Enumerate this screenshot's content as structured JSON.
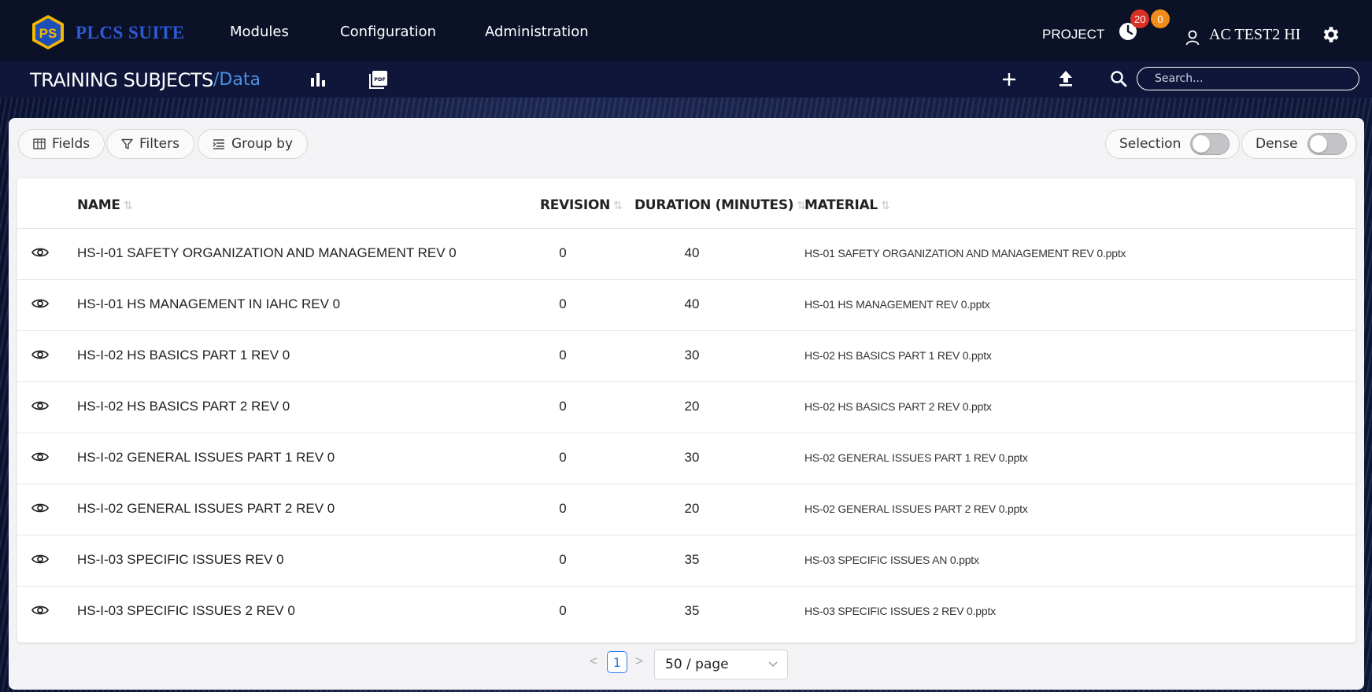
{
  "app": {
    "brand": "PLCS SUITE",
    "logo_text": "PS"
  },
  "nav": {
    "items": [
      "Modules",
      "Configuration",
      "Administration"
    ],
    "project_label": "PROJECT",
    "badge_red": "20",
    "badge_orange": "0",
    "user_name": "AC TEST2 HI"
  },
  "subheader": {
    "title": "TRAINING SUBJECTS",
    "path": "/Data",
    "search_placeholder": "Search..."
  },
  "toolbar": {
    "fields_label": "Fields",
    "filters_label": "Filters",
    "groupby_label": "Group by",
    "selection_label": "Selection",
    "dense_label": "Dense"
  },
  "table": {
    "columns": {
      "name": "NAME",
      "revision": "REVISION",
      "duration": "DURATION (MINUTES)",
      "material": "MATERIAL"
    },
    "rows": [
      {
        "name": "HS-I-01 SAFETY ORGANIZATION AND MANAGEMENT REV 0",
        "revision": "0",
        "duration": "40",
        "material": "HS-01 SAFETY ORGANIZATION AND MANAGEMENT REV 0.pptx"
      },
      {
        "name": "HS-I-01 HS MANAGEMENT IN IAHC REV 0",
        "revision": "0",
        "duration": "40",
        "material": "HS-01 HS MANAGEMENT REV 0.pptx"
      },
      {
        "name": "HS-I-02 HS BASICS PART 1 REV 0",
        "revision": "0",
        "duration": "30",
        "material": "HS-02 HS BASICS PART 1 REV 0.pptx"
      },
      {
        "name": "HS-I-02 HS BASICS PART 2 REV 0",
        "revision": "0",
        "duration": "20",
        "material": "HS-02 HS BASICS PART 2 REV 0.pptx"
      },
      {
        "name": "HS-I-02 GENERAL ISSUES PART 1 REV 0",
        "revision": "0",
        "duration": "30",
        "material": "HS-02 GENERAL ISSUES PART 1 REV 0.pptx"
      },
      {
        "name": "HS-I-02 GENERAL ISSUES PART 2 REV 0",
        "revision": "0",
        "duration": "20",
        "material": "HS-02 GENERAL ISSUES PART 2 REV 0.pptx"
      },
      {
        "name": "HS-I-03 SPECIFIC ISSUES REV 0",
        "revision": "0",
        "duration": "35",
        "material": "HS-03 SPECIFIC ISSUES AN 0.pptx"
      },
      {
        "name": "HS-I-03 SPECIFIC ISSUES 2 REV 0",
        "revision": "0",
        "duration": "35",
        "material": "HS-03 SPECIFIC ISSUES 2 REV 0.pptx"
      }
    ]
  },
  "pagination": {
    "current_page": "1",
    "page_size": "50 / page"
  },
  "icons": {
    "logo": "ps-logo-icon",
    "clock": "clock-icon",
    "user": "user-icon",
    "settings": "gear-icon",
    "chart": "bar-chart-icon",
    "pdf": "pdf-icon",
    "add": "plus-icon",
    "upload": "upload-icon",
    "search": "search-icon",
    "view": "eye-icon"
  },
  "colors": {
    "brand_blue": "#2d5bd6",
    "accent_blue": "#4a90e2",
    "badge_red": "#d93025",
    "badge_orange": "#f08c1a",
    "logo_gold": "#f5b700",
    "page_active": "#2e7cf6"
  }
}
